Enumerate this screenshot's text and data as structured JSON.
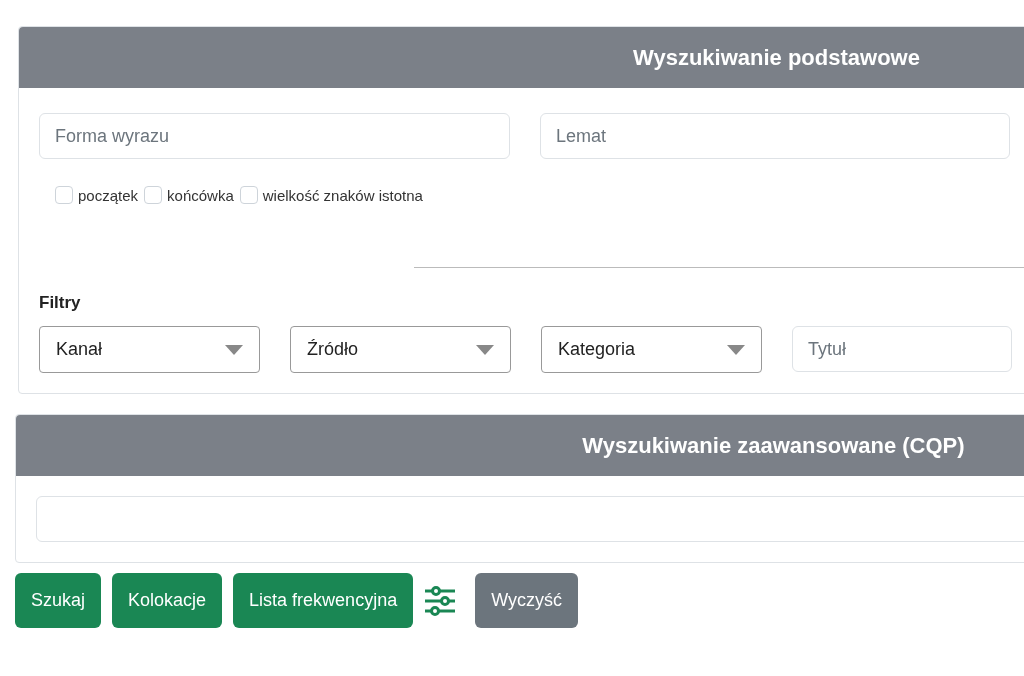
{
  "basic_search": {
    "title": "Wyszukiwanie podstawowe",
    "fields": [
      {
        "placeholder": "Forma wyrazu"
      },
      {
        "placeholder": "Lemat"
      }
    ],
    "options": [
      {
        "label": "początek",
        "checked": false
      },
      {
        "label": "końcówka",
        "checked": false
      },
      {
        "label": "wielkość znaków istotna",
        "checked": false
      }
    ],
    "filters_label": "Filtry",
    "filters": [
      {
        "kind": "select",
        "label": "Kanał"
      },
      {
        "kind": "select",
        "label": "Źródło"
      },
      {
        "kind": "select",
        "label": "Kategoria"
      },
      {
        "kind": "input",
        "placeholder": "Tytuł"
      }
    ]
  },
  "advanced_search": {
    "title": "Wyszukiwanie zaawansowane (CQP)"
  },
  "buttons": [
    {
      "kind": "primary",
      "label": "Szukaj"
    },
    {
      "kind": "primary",
      "label": "Kolokacje"
    },
    {
      "kind": "primary",
      "label": "Lista frekwencyjna"
    },
    {
      "kind": "icon"
    },
    {
      "kind": "secondary",
      "label": "Wyczyść"
    }
  ]
}
